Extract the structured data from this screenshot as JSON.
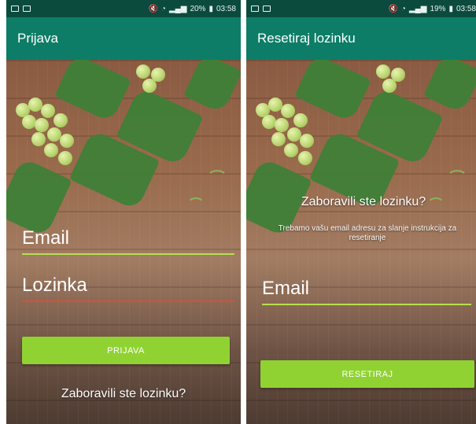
{
  "left": {
    "status": {
      "percent": "20%",
      "time": "03:58"
    },
    "title": "Prijava",
    "email_placeholder": "Email",
    "password_placeholder": "Lozinka",
    "login_button": "PRIJAVA",
    "forgot_link": "Zaboravili ste lozinku?"
  },
  "right": {
    "status": {
      "percent": "19%",
      "time": "03:58"
    },
    "title": "Resetiraj lozinku",
    "heading": "Zaboravili ste lozinku?",
    "description": "Trebamo vašu email adresu za slanje instrukcija za resetiranje",
    "email_placeholder": "Email",
    "reset_button": "RESETIRAJ"
  },
  "colors": {
    "status_bar": "#0b4b3e",
    "app_bar": "#0d7d67",
    "button": "#90d232",
    "email_line": "#b6df4f",
    "password_line": "#e04c3a",
    "text": "#ffffff"
  },
  "icons": [
    "gallery-icon",
    "image-icon",
    "mute-icon",
    "wifi-icon",
    "signal-icon",
    "battery-icon"
  ]
}
